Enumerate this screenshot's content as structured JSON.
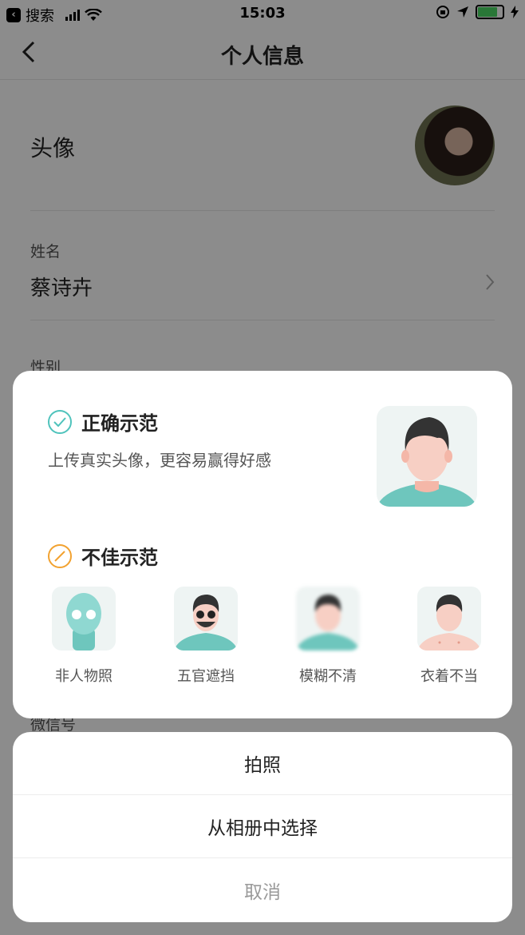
{
  "status_bar": {
    "back_app_label": "搜索",
    "time": "15:03"
  },
  "nav": {
    "title": "个人信息"
  },
  "profile": {
    "avatar_label": "头像",
    "name_label": "姓名",
    "name_value": "蔡诗卉",
    "gender_label": "性别",
    "wechat_label": "微信号"
  },
  "tip": {
    "good_title": "正确示范",
    "good_desc": "上传真实头像，更容易赢得好感",
    "bad_title": "不佳示范",
    "bad_examples": [
      {
        "label": "非人物照",
        "icon": "alien-icon"
      },
      {
        "label": "五官遮挡",
        "icon": "sunglasses-man-icon"
      },
      {
        "label": "模糊不清",
        "icon": "blurred-man-icon"
      },
      {
        "label": "衣着不当",
        "icon": "shirtless-man-icon"
      }
    ]
  },
  "sheet": {
    "take_photo": "拍照",
    "choose_album": "从相册中选择",
    "cancel": "取消"
  },
  "colors": {
    "accent_good": "#4fc3bc",
    "accent_bad": "#f2a230",
    "battery": "#4cd964"
  }
}
